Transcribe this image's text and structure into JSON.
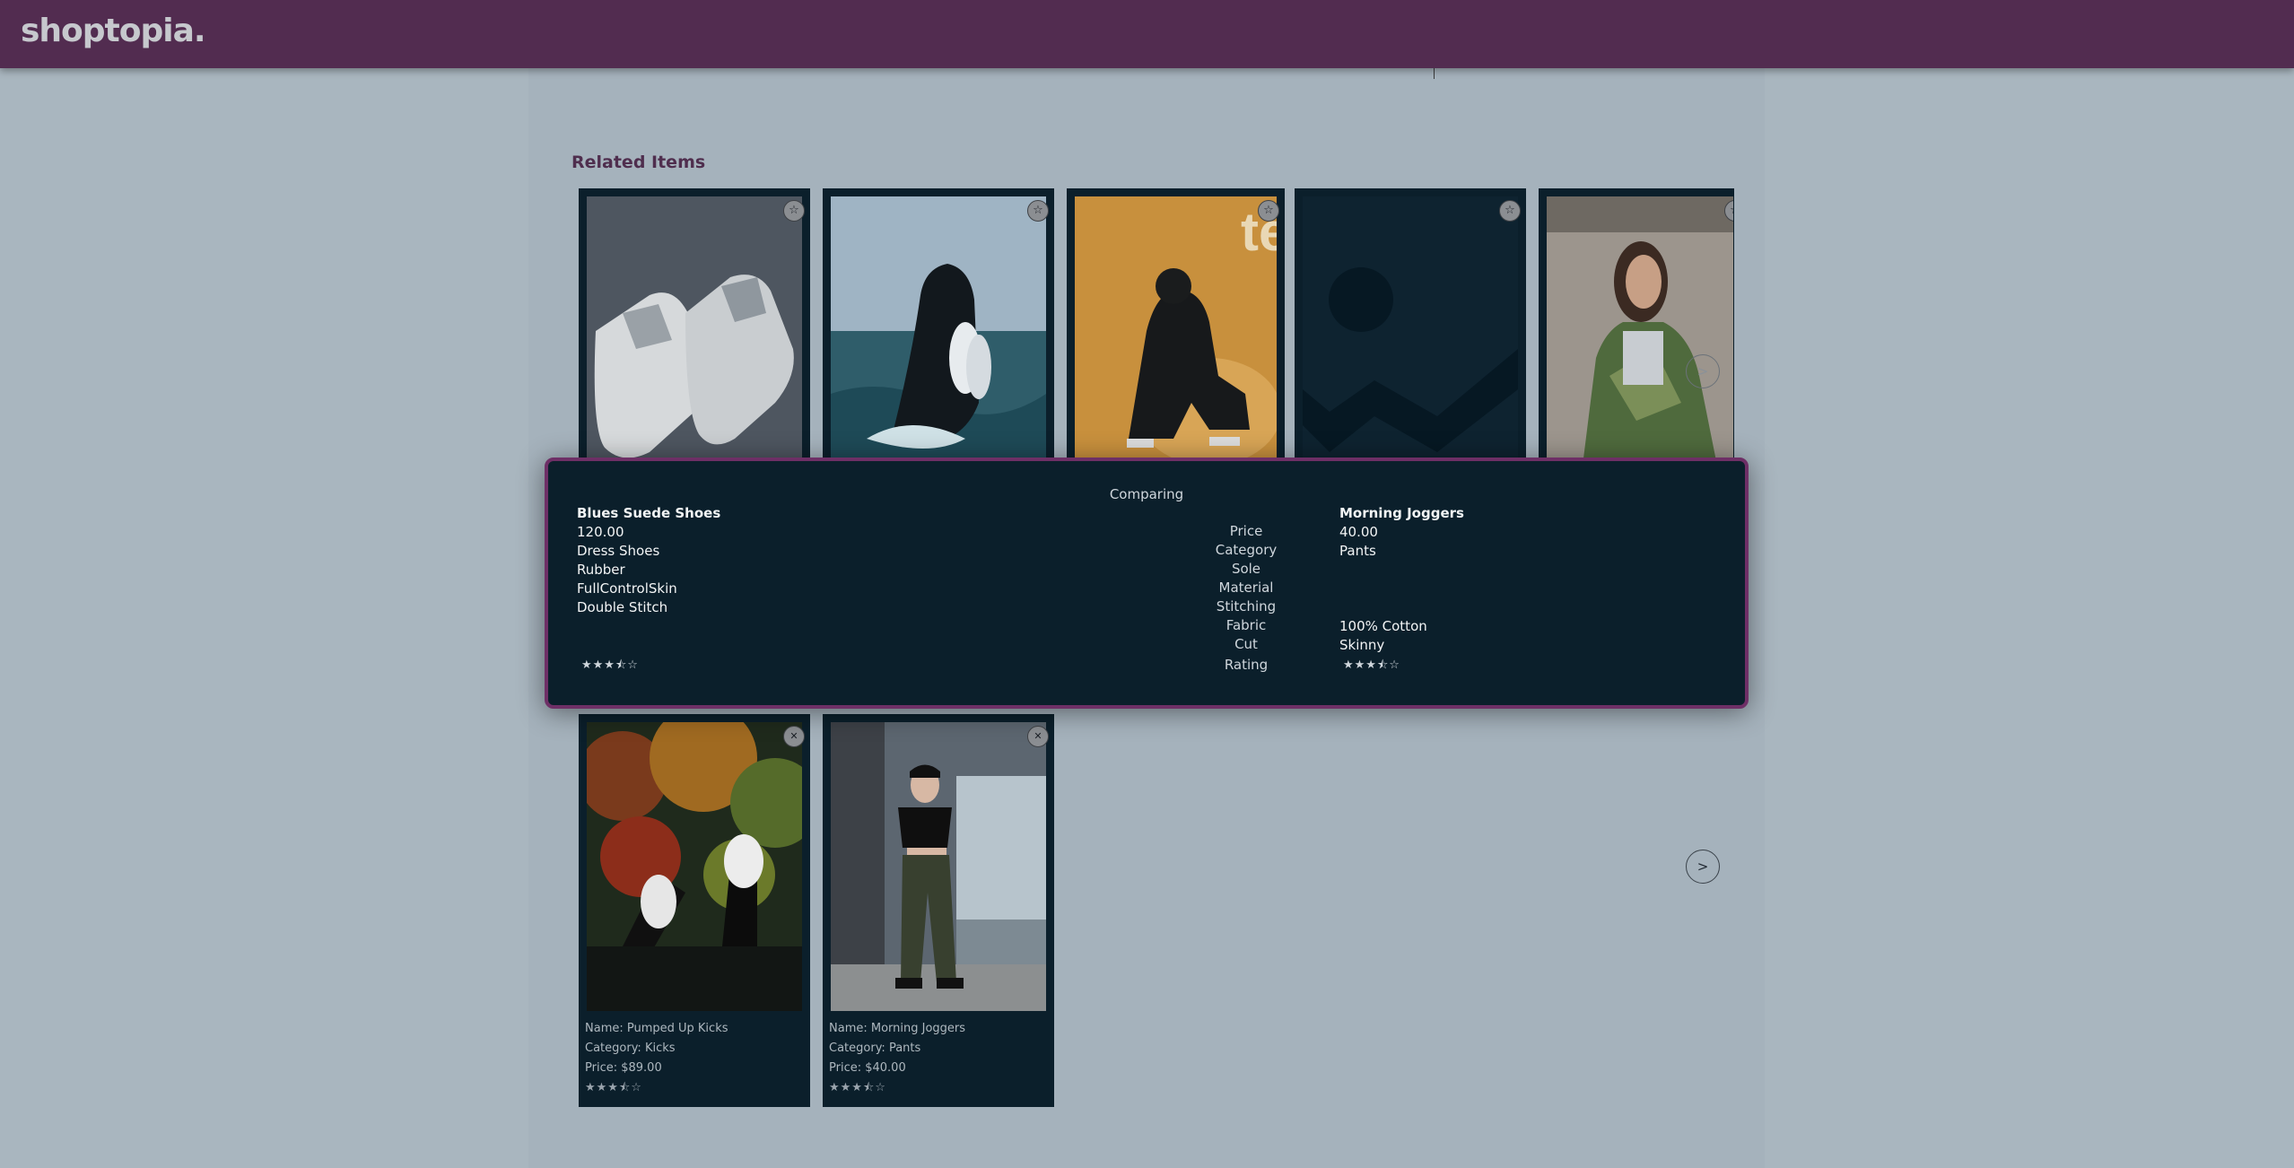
{
  "header": {
    "logo": "shoptopia."
  },
  "related": {
    "title": "Related Items",
    "star_icon": "☆",
    "next_label": ">"
  },
  "outfit": {
    "remove_icon": "✕",
    "next_label": ">",
    "items": [
      {
        "name": "Name: Pumped Up Kicks",
        "category": "Category: Kicks",
        "price": "Price: $89.00",
        "stars": "★★★⯪☆"
      },
      {
        "name": "Name: Morning Joggers",
        "category": "Category: Pants",
        "price": "Price: $40.00",
        "stars": "★★★⯪☆"
      }
    ]
  },
  "comparison": {
    "title": "Comparing",
    "left": {
      "name": "Blues Suede Shoes",
      "price": "120.00",
      "category": "Dress Shoes",
      "sole": "Rubber",
      "material": "FullControlSkin",
      "stitching": "Double Stitch",
      "stars": "★★★⯪☆"
    },
    "features": [
      "Price",
      "Category",
      "Sole",
      "Material",
      "Stitching",
      "Fabric",
      "Cut"
    ],
    "rating_label": "Rating",
    "right": {
      "name": "Morning Joggers",
      "price": "40.00",
      "category": "Pants",
      "fabric": "100% Cotton",
      "cut": "Skinny",
      "stars": "★★★⯪☆"
    }
  }
}
